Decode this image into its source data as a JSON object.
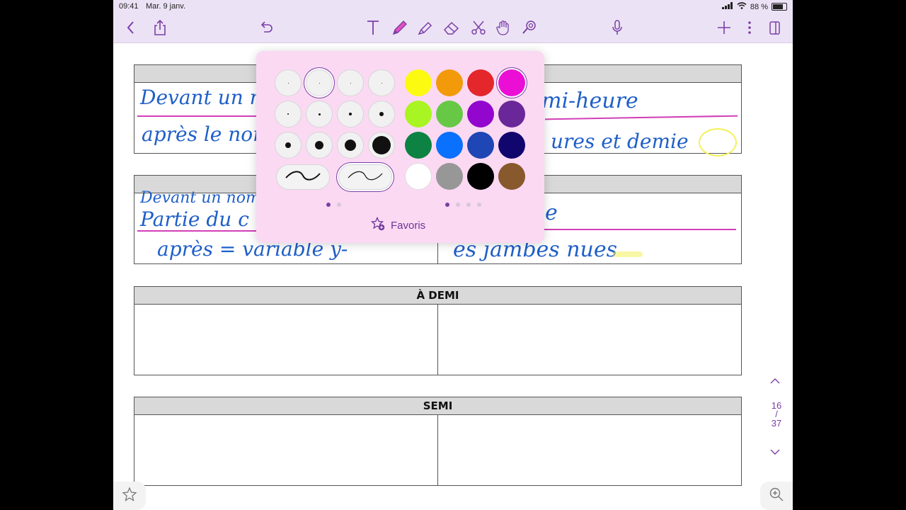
{
  "status": {
    "time": "09:41",
    "date": "Mar. 9 janv.",
    "battery": "88 %",
    "battery_level": 0.88
  },
  "toolbar": {
    "icons": [
      "back-icon",
      "share-icon",
      "undo-icon",
      "text-tool-icon",
      "pen-tool-icon",
      "highlighter-tool-icon",
      "eraser-tool-icon",
      "scissors-tool-icon",
      "hand-tool-icon",
      "laser-pointer-icon",
      "microphone-icon",
      "add-icon",
      "more-icon",
      "pages-icon"
    ],
    "active_tool": "pen-tool-icon",
    "accent": "#7a3fa6"
  },
  "tables": [
    {
      "header": "",
      "handwriting": [
        "Devant un no",
        "après le nom",
        "mi-heure",
        "ures et demie"
      ]
    },
    {
      "header": "",
      "handwriting": [
        "Devant un nom",
        "Partie du c",
        "après = variable y-",
        "es jambes nues",
        "e"
      ]
    },
    {
      "header": "À DEMI"
    },
    {
      "header": "SEMI"
    }
  ],
  "page_nav": {
    "current": "16",
    "separator": "/",
    "total": "37"
  },
  "popup": {
    "favorites_label": "Favoris",
    "size_dots": [
      1,
      1,
      1,
      1,
      2,
      3,
      4,
      6,
      8,
      12,
      16,
      26
    ],
    "selected_size_index": 1,
    "colors": [
      "#fbfa10",
      "#f39a0b",
      "#e3272b",
      "#eb0fd6",
      "#a9f423",
      "#67c846",
      "#9206cd",
      "#6a2799",
      "#0c8243",
      "#0a70fe",
      "#1e46b4",
      "#10066e",
      "#ffffff",
      "#979797",
      "#000000",
      "#87592c"
    ],
    "selected_color_index": 3,
    "stroke_styles": [
      "plain-stroke",
      "pressure-stroke"
    ],
    "selected_stroke_index": 1,
    "size_pager": {
      "pages": 2,
      "current": 0
    },
    "color_pager": {
      "pages": 4,
      "current": 0
    },
    "ink": "#d23fb8",
    "highlight": "#f3f15a"
  }
}
